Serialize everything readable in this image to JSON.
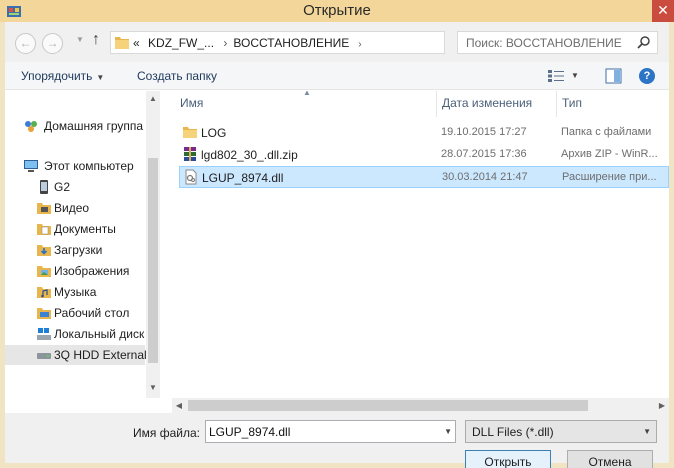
{
  "window": {
    "title": "Открытие"
  },
  "nav": {
    "back_icon": "back-arrow-icon",
    "forward_icon": "forward-arrow-icon",
    "up_icon": "up-arrow-icon",
    "breadcrumb_overflow": "«",
    "breadcrumb": [
      "KDZ_FW_...",
      "ВОССТАНОВЛЕНИЕ"
    ],
    "search_placeholder": "Поиск: ВОССТАНОВЛЕНИЕ"
  },
  "toolbar": {
    "organize_label": "Упорядочить",
    "new_folder_label": "Создать папку"
  },
  "sidebar": {
    "items": [
      {
        "label": "Домашняя группа",
        "icon": "homegroup-icon"
      },
      {
        "label": "Этот компьютер",
        "icon": "computer-icon"
      },
      {
        "label": "G2",
        "icon": "phone-icon"
      },
      {
        "label": "Видео",
        "icon": "video-folder-icon"
      },
      {
        "label": "Документы",
        "icon": "documents-folder-icon"
      },
      {
        "label": "Загрузки",
        "icon": "downloads-folder-icon"
      },
      {
        "label": "Изображения",
        "icon": "pictures-folder-icon"
      },
      {
        "label": "Музыка",
        "icon": "music-folder-icon"
      },
      {
        "label": "Рабочий стол",
        "icon": "desktop-folder-icon"
      },
      {
        "label": "Локальный диск",
        "icon": "local-disk-icon"
      },
      {
        "label": "3Q HDD External",
        "icon": "external-drive-icon"
      }
    ]
  },
  "filelist": {
    "columns": [
      "Имя",
      "Дата изменения",
      "Тип"
    ],
    "rows": [
      {
        "name": "LOG",
        "date": "19.10.2015 17:27",
        "type": "Папка с файлами",
        "icon": "folder-icon"
      },
      {
        "name": "lgd802_30_.dll.zip",
        "date": "28.07.2015 17:36",
        "type": "Архив ZIP - WinR...",
        "icon": "winrar-archive-icon"
      },
      {
        "name": "LGUP_8974.dll",
        "date": "30.03.2014 21:47",
        "type": "Расширение при...",
        "icon": "dll-file-icon"
      }
    ],
    "selected_index": 2
  },
  "bottom": {
    "filename_label": "Имя файла:",
    "filename_value": "LGUP_8974.dll",
    "filetype_value": "DLL Files (*.dll)",
    "open_label": "Открыть",
    "cancel_label": "Отмена"
  },
  "colors": {
    "titlebar": "#f3d79a",
    "selection": "#cce8ff",
    "close_button": "#c94c3f"
  }
}
